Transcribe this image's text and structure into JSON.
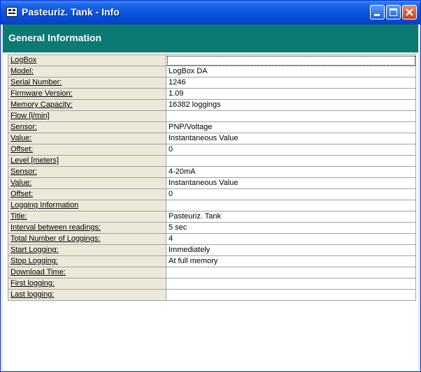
{
  "window": {
    "title": "Pasteuriz. Tank - Info",
    "colors": {
      "titlebar": "#0a55e0",
      "header": "#0a7a72",
      "label_bg": "#ece9d8",
      "close_button": "#c4401f"
    }
  },
  "header": {
    "title": "General Information"
  },
  "rows": [
    {
      "label": "LogBox",
      "value": ""
    },
    {
      "label": "Model:",
      "value": "LogBox DA"
    },
    {
      "label": "Serial Number:",
      "value": "1246"
    },
    {
      "label": "Firmware Version:",
      "value": "1.09"
    },
    {
      "label": "Memory Capacity:",
      "value": "16382 loggings"
    },
    {
      "label": "Flow [l/min]",
      "value": ""
    },
    {
      "label": "Sensor:",
      "value": "PNP/Voltage"
    },
    {
      "label": "Value:",
      "value": "Instantaneous Value"
    },
    {
      "label": "Offset:",
      "value": "0"
    },
    {
      "label": "Level [meters]",
      "value": ""
    },
    {
      "label": "Sensor:",
      "value": "4-20mA"
    },
    {
      "label": "Value:",
      "value": "Instantaneous Value"
    },
    {
      "label": "Offset:",
      "value": "0"
    },
    {
      "label": "Logging Information",
      "value": ""
    },
    {
      "label": "Title:",
      "value": "Pasteuriz. Tank"
    },
    {
      "label": "Interval between readings:",
      "value": "5 sec"
    },
    {
      "label": "Total Number of Loggings:",
      "value": "4"
    },
    {
      "label": "Start Logging:",
      "value": "Immediately"
    },
    {
      "label": "Stop Logging:",
      "value": "At full memory"
    },
    {
      "label": "Download Time:",
      "value": ""
    },
    {
      "label": "First logging:",
      "value": ""
    },
    {
      "label": "Last logging:",
      "value": ""
    }
  ]
}
